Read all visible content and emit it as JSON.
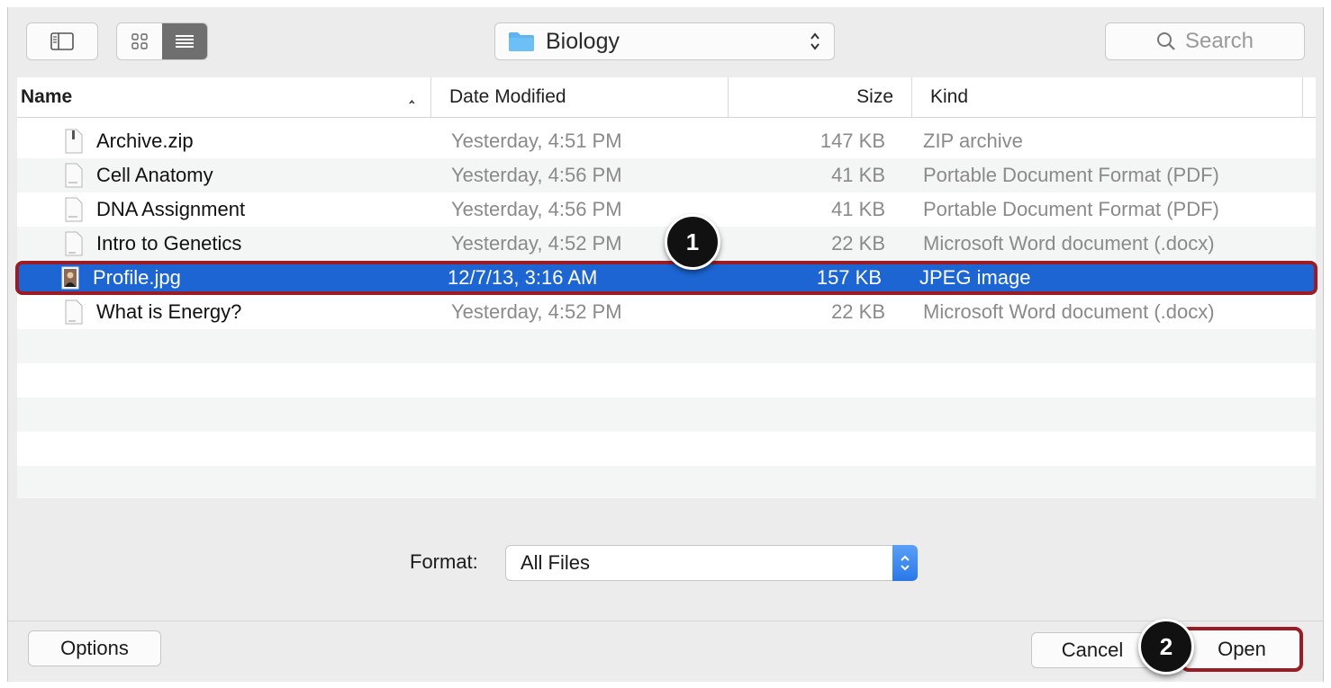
{
  "toolbar": {
    "location": "Biology",
    "search_placeholder": "Search"
  },
  "columns": {
    "name": "Name",
    "date": "Date Modified",
    "size": "Size",
    "kind": "Kind"
  },
  "files": [
    {
      "name": "Archive.zip",
      "date": "Yesterday, 4:51 PM",
      "size": "147 KB",
      "kind": "ZIP archive",
      "icon": "zip-file-icon"
    },
    {
      "name": "Cell Anatomy",
      "date": "Yesterday, 4:56 PM",
      "size": "41 KB",
      "kind": "Portable Document Format (PDF)",
      "icon": "pdf-file-icon"
    },
    {
      "name": "DNA Assignment",
      "date": "Yesterday, 4:56 PM",
      "size": "41 KB",
      "kind": "Portable Document Format (PDF)",
      "icon": "pdf-file-icon"
    },
    {
      "name": "Intro to Genetics",
      "date": "Yesterday, 4:52 PM",
      "size": "22 KB",
      "kind": "Microsoft Word document (.docx)",
      "icon": "docx-file-icon"
    },
    {
      "name": "Profile.jpg",
      "date": "12/7/13, 3:16 AM",
      "size": "157 KB",
      "kind": "JPEG image",
      "icon": "image-file-icon",
      "selected": true
    },
    {
      "name": "What is Energy?",
      "date": "Yesterday, 4:52 PM",
      "size": "22 KB",
      "kind": "Microsoft Word document (.docx)",
      "icon": "docx-file-icon"
    }
  ],
  "format": {
    "label": "Format:",
    "value": "All Files"
  },
  "buttons": {
    "options": "Options",
    "cancel": "Cancel",
    "open": "Open"
  },
  "callouts": [
    "1",
    "2"
  ],
  "colors": {
    "selection": "#1c65d2",
    "highlight_border": "#9b1c25",
    "folder": "#5fb4f0"
  }
}
